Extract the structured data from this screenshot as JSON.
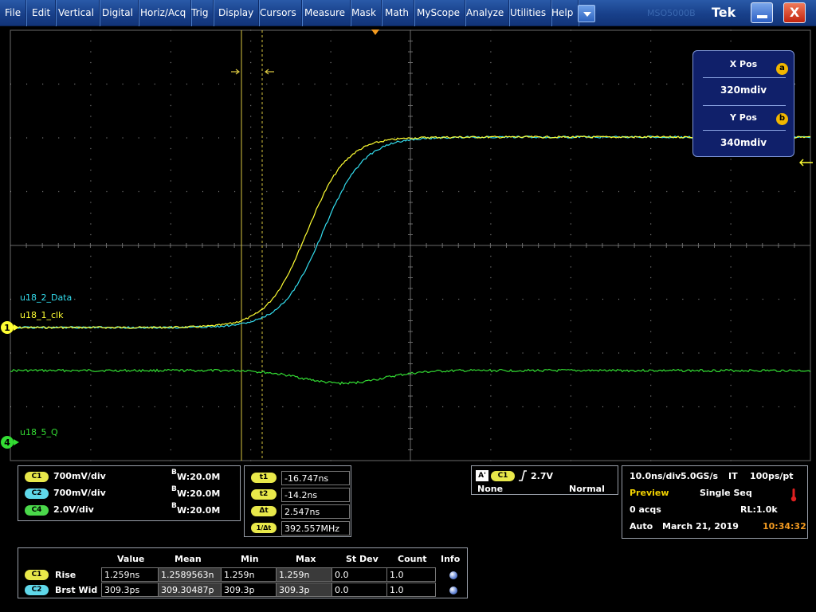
{
  "menubar": {
    "items": [
      "File",
      "Edit",
      "Vertical",
      "Digital",
      "Horiz/Acq",
      "Trig",
      "Display",
      "Cursors",
      "Measure",
      "Mask",
      "Math",
      "MyScope",
      "Analyze",
      "Utilities",
      "Help"
    ],
    "brand_faint": "MSO5000B",
    "brand": "Tek",
    "close_label": "X"
  },
  "channel_markers": {
    "ch1": "1",
    "ch4": "4"
  },
  "waveform_labels": {
    "data": "u18_2_Data",
    "clk": "u18_1_clk",
    "q": "u18_5_Q"
  },
  "colors": {
    "ch1": "#ffff33",
    "ch2": "#33ddee",
    "ch4": "#33dd33",
    "cursor": "#d9c640",
    "grid": "#6a6a6a",
    "accent": "#f2b600"
  },
  "pos_popup": {
    "x_title": "X Pos",
    "x_badge": "a",
    "x_value": "320mdiv",
    "y_title": "Y Pos",
    "y_badge": "b",
    "y_value": "340mdiv"
  },
  "vertical": {
    "rows": [
      {
        "ch": "C1",
        "scale": "700mV/div",
        "bw": "B",
        "bwval": "W:20.0M"
      },
      {
        "ch": "C2",
        "scale": "700mV/div",
        "bw": "B",
        "bwval": "W:20.0M"
      },
      {
        "ch": "C4",
        "scale": "2.0V/div",
        "bw": "B",
        "bwval": "W:20.0M"
      }
    ]
  },
  "cursors": {
    "rows": [
      {
        "label": "t1",
        "value": "-16.747ns"
      },
      {
        "label": "t2",
        "value": "-14.2ns"
      },
      {
        "label": "Δt",
        "value": "2.547ns"
      },
      {
        "label": "1/Δt",
        "value": "392.557MHz"
      }
    ]
  },
  "trigger": {
    "badge": "A'",
    "ch": "C1",
    "level": "2.7V",
    "source": "None",
    "mode": "Normal"
  },
  "acquisition": {
    "scale": "10.0ns/div",
    "rate": "5.0GS/s",
    "it": "IT",
    "res": "100ps/pt",
    "status": "Preview",
    "mode": "Single Seq",
    "acqs": "0 acqs",
    "rl": "RL:1.0k",
    "auto": "Auto",
    "date": "March 21, 2019",
    "time": "10:34:32"
  },
  "measurements": {
    "headers": [
      "Value",
      "Mean",
      "Min",
      "Max",
      "St Dev",
      "Count",
      "Info"
    ],
    "rows": [
      {
        "ch": "C1",
        "name": "Rise",
        "values": [
          "1.259ns",
          "1.2589563n",
          "1.259n",
          "1.259n",
          "0.0",
          "1.0"
        ]
      },
      {
        "ch": "C2",
        "name": "Brst Wid",
        "values": [
          "309.3ps",
          "309.30487p",
          "309.3p",
          "309.3p",
          "0.0",
          "1.0"
        ]
      }
    ]
  }
}
